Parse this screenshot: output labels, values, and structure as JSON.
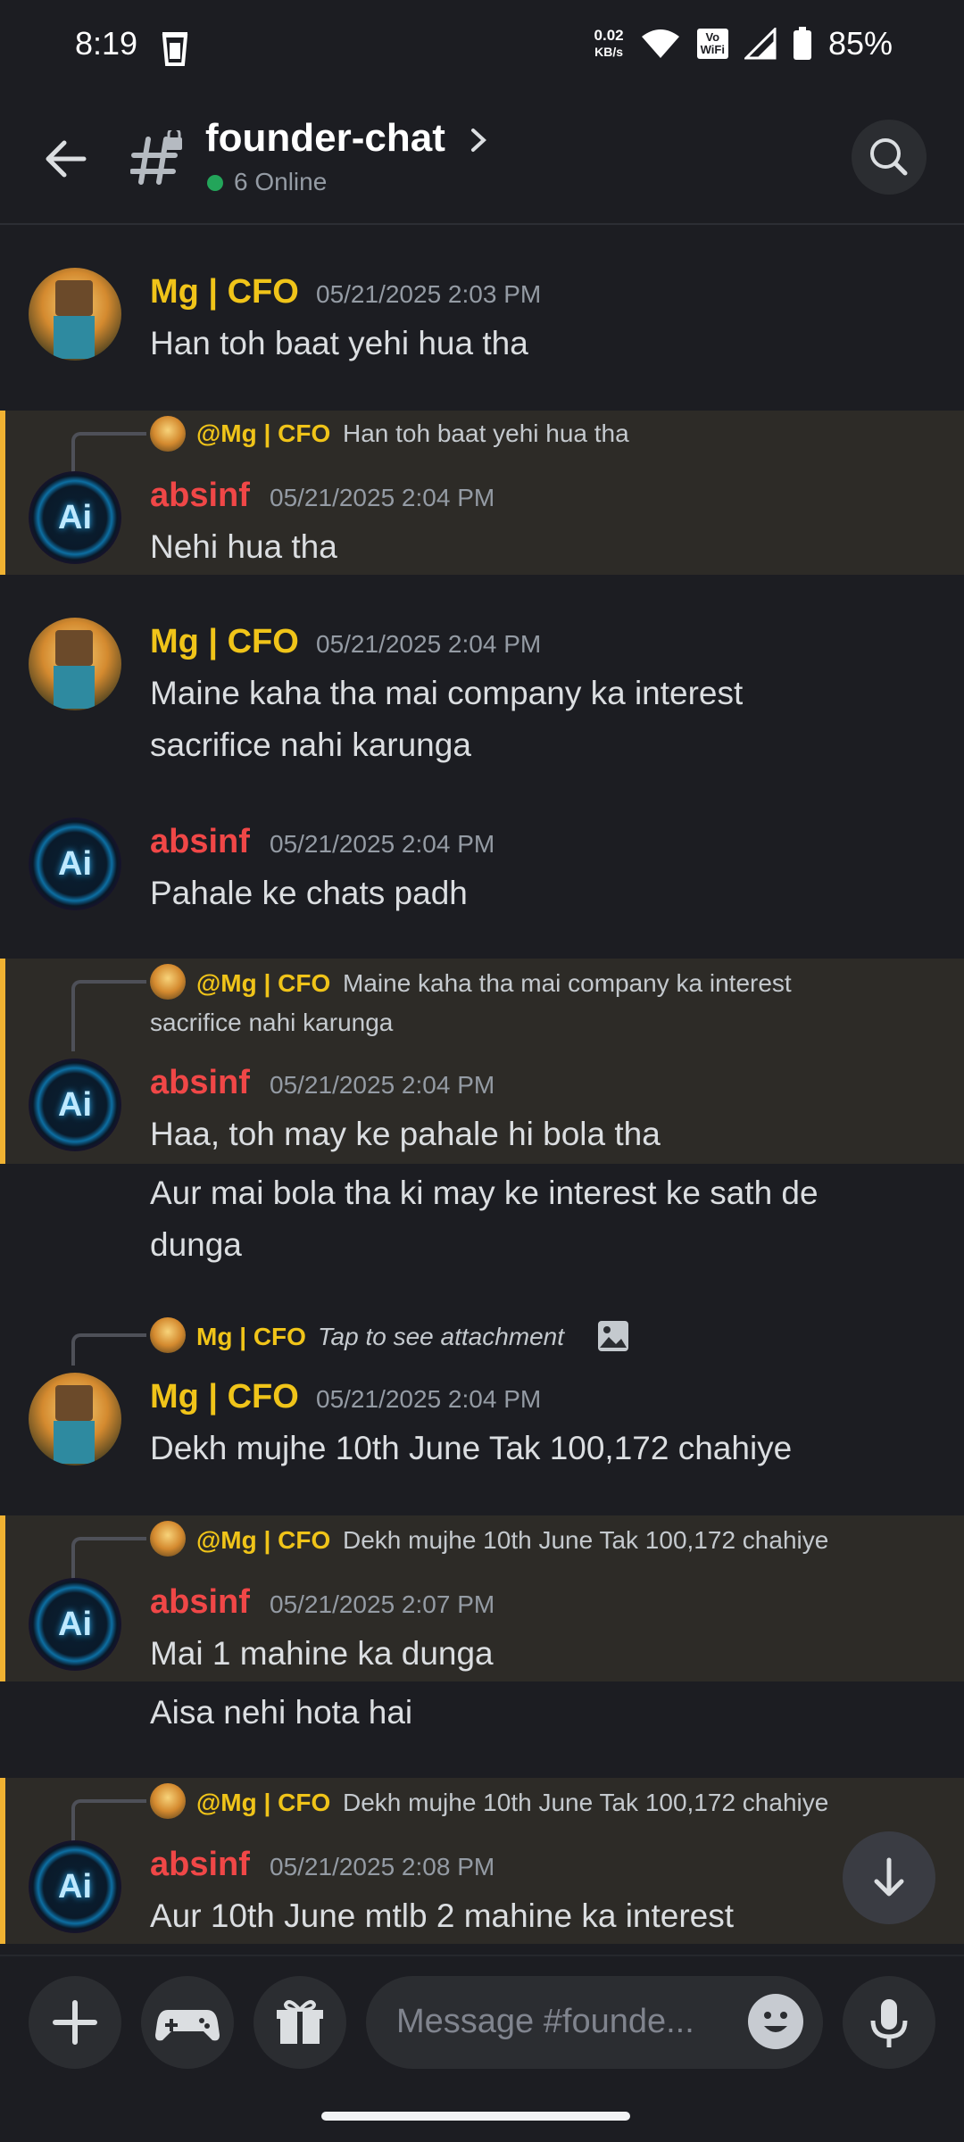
{
  "status_bar": {
    "time": "8:19",
    "net_speed_value": "0.02",
    "net_speed_unit": "KB/s",
    "vowifi_line1": "Vo",
    "vowifi_line2": "WiFi",
    "battery": "85%"
  },
  "header": {
    "channel_name": "founder-chat",
    "online": "6 Online"
  },
  "messages": [
    {
      "author": "Mg | CFO",
      "timestamp": "05/21/2025 2:03 PM",
      "lines": [
        "Han toh baat yehi hua tha"
      ]
    },
    {
      "reply_author": "@Mg | CFO",
      "reply_text": "Han toh baat yehi hua tha",
      "author": "absinf",
      "timestamp": "05/21/2025 2:04 PM",
      "lines": [
        "Nehi hua tha"
      ]
    },
    {
      "author": "Mg | CFO",
      "timestamp": "05/21/2025 2:04 PM",
      "lines": [
        "Maine kaha tha mai company ka interest",
        "sacrifice nahi karunga"
      ]
    },
    {
      "author": "absinf",
      "timestamp": "05/21/2025 2:04 PM",
      "lines": [
        "Pahale ke chats padh"
      ]
    },
    {
      "reply_author": "@Mg | CFO",
      "reply_text": "Maine kaha tha mai company ka interest",
      "reply_text_2": "sacrifice nahi karunga",
      "author": "absinf",
      "timestamp": "05/21/2025 2:04 PM",
      "lines": [
        "Haa, toh may ke pahale hi bola tha"
      ],
      "followup": [
        "Aur mai bola tha ki may ke interest ke sath de",
        "dunga"
      ]
    },
    {
      "reply_author": "Mg | CFO",
      "reply_text": "Tap to see attachment",
      "author": "Mg | CFO",
      "timestamp": "05/21/2025 2:04 PM",
      "lines": [
        "Dekh mujhe 10th June Tak 100,172 chahiye"
      ]
    },
    {
      "reply_author": "@Mg | CFO",
      "reply_text": "Dekh mujhe 10th June Tak 100,172 chahiye",
      "author": "absinf",
      "timestamp": "05/21/2025 2:07 PM",
      "lines": [
        "Mai 1 mahine ka dunga"
      ],
      "followup": [
        "Aisa nehi hota hai"
      ]
    },
    {
      "reply_author": "@Mg | CFO",
      "reply_text": "Dekh mujhe 10th June Tak 100,172 chahiye",
      "author": "absinf",
      "timestamp": "05/21/2025 2:08 PM",
      "lines": [
        "Aur 10th June mtlb 2 mahine ka interest"
      ]
    }
  ],
  "input": {
    "placeholder": "Message #founde..."
  },
  "avatar_text": "Ai",
  "colors": {
    "background": "#1c1d22",
    "mg_name": "#f0c419",
    "absinf_name": "#f04747",
    "reply_highlight": "#2d2b27",
    "reply_bar": "#f0b232",
    "online": "#23a55a"
  },
  "icons": [
    "back-arrow-icon",
    "channel-hash-lock-icon",
    "chevron-right-icon",
    "search-icon",
    "plus-icon",
    "gamepad-icon",
    "gift-icon",
    "emoji-icon",
    "microphone-icon",
    "arrow-down-icon",
    "image-icon",
    "wifi-icon",
    "signal-icon",
    "battery-icon",
    "trash-icon"
  ]
}
